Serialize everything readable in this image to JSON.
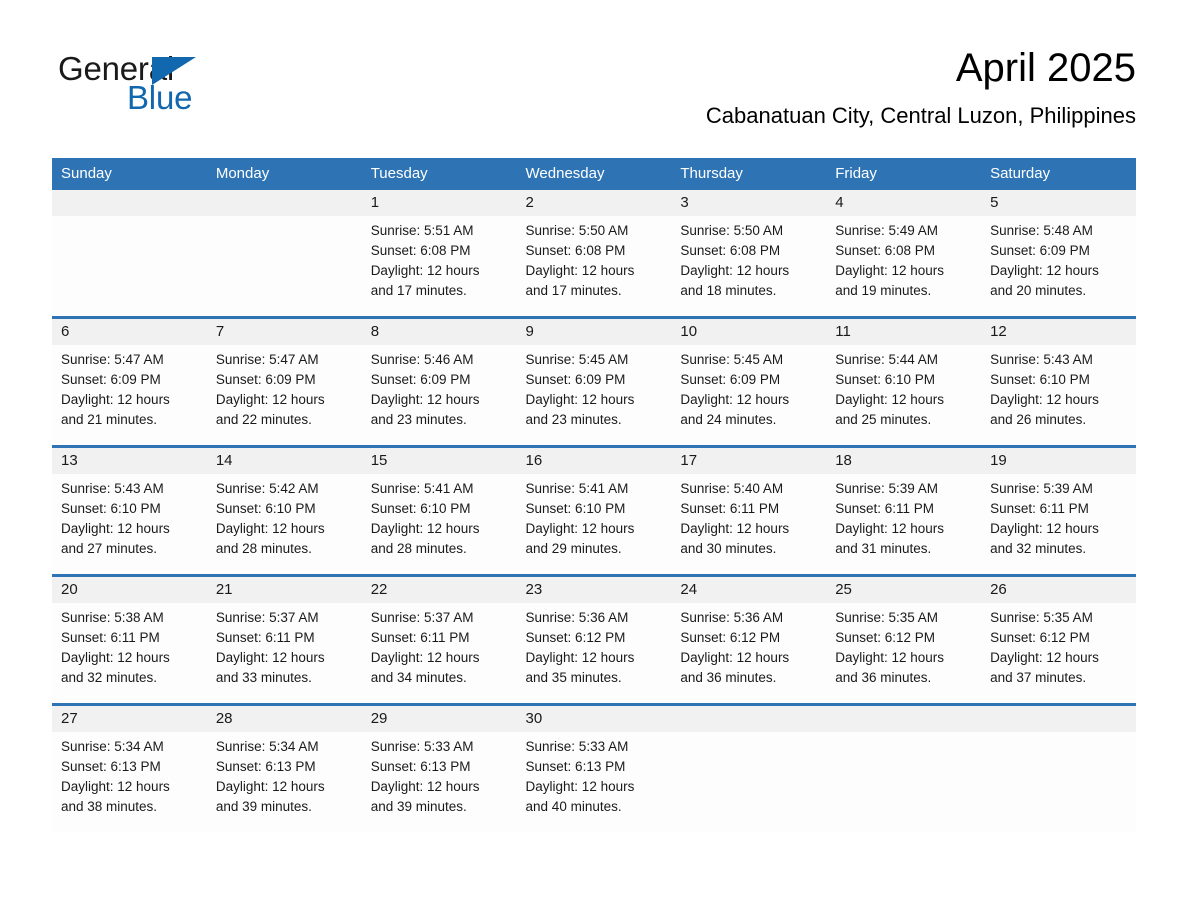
{
  "logo": {
    "word_dark": "General",
    "word_blue": "Blue",
    "triangle_icon": "triangle-icon",
    "brand_blue": "#1168ae"
  },
  "header": {
    "month_title": "April 2025",
    "location": "Cabanatuan City, Central Luzon, Philippines",
    "accent_blue": "#2e74b5",
    "daynum_band": "#f1f1f1"
  },
  "weekday_headers": [
    "Sunday",
    "Monday",
    "Tuesday",
    "Wednesday",
    "Thursday",
    "Friday",
    "Saturday"
  ],
  "weeks": [
    {
      "days": [
        {
          "num": "",
          "lines": []
        },
        {
          "num": "",
          "lines": []
        },
        {
          "num": "1",
          "lines": [
            "Sunrise: 5:51 AM",
            "Sunset: 6:08 PM",
            "Daylight: 12 hours",
            "and 17 minutes."
          ]
        },
        {
          "num": "2",
          "lines": [
            "Sunrise: 5:50 AM",
            "Sunset: 6:08 PM",
            "Daylight: 12 hours",
            "and 17 minutes."
          ]
        },
        {
          "num": "3",
          "lines": [
            "Sunrise: 5:50 AM",
            "Sunset: 6:08 PM",
            "Daylight: 12 hours",
            "and 18 minutes."
          ]
        },
        {
          "num": "4",
          "lines": [
            "Sunrise: 5:49 AM",
            "Sunset: 6:08 PM",
            "Daylight: 12 hours",
            "and 19 minutes."
          ]
        },
        {
          "num": "5",
          "lines": [
            "Sunrise: 5:48 AM",
            "Sunset: 6:09 PM",
            "Daylight: 12 hours",
            "and 20 minutes."
          ]
        }
      ]
    },
    {
      "days": [
        {
          "num": "6",
          "lines": [
            "Sunrise: 5:47 AM",
            "Sunset: 6:09 PM",
            "Daylight: 12 hours",
            "and 21 minutes."
          ]
        },
        {
          "num": "7",
          "lines": [
            "Sunrise: 5:47 AM",
            "Sunset: 6:09 PM",
            "Daylight: 12 hours",
            "and 22 minutes."
          ]
        },
        {
          "num": "8",
          "lines": [
            "Sunrise: 5:46 AM",
            "Sunset: 6:09 PM",
            "Daylight: 12 hours",
            "and 23 minutes."
          ]
        },
        {
          "num": "9",
          "lines": [
            "Sunrise: 5:45 AM",
            "Sunset: 6:09 PM",
            "Daylight: 12 hours",
            "and 23 minutes."
          ]
        },
        {
          "num": "10",
          "lines": [
            "Sunrise: 5:45 AM",
            "Sunset: 6:09 PM",
            "Daylight: 12 hours",
            "and 24 minutes."
          ]
        },
        {
          "num": "11",
          "lines": [
            "Sunrise: 5:44 AM",
            "Sunset: 6:10 PM",
            "Daylight: 12 hours",
            "and 25 minutes."
          ]
        },
        {
          "num": "12",
          "lines": [
            "Sunrise: 5:43 AM",
            "Sunset: 6:10 PM",
            "Daylight: 12 hours",
            "and 26 minutes."
          ]
        }
      ]
    },
    {
      "days": [
        {
          "num": "13",
          "lines": [
            "Sunrise: 5:43 AM",
            "Sunset: 6:10 PM",
            "Daylight: 12 hours",
            "and 27 minutes."
          ]
        },
        {
          "num": "14",
          "lines": [
            "Sunrise: 5:42 AM",
            "Sunset: 6:10 PM",
            "Daylight: 12 hours",
            "and 28 minutes."
          ]
        },
        {
          "num": "15",
          "lines": [
            "Sunrise: 5:41 AM",
            "Sunset: 6:10 PM",
            "Daylight: 12 hours",
            "and 28 minutes."
          ]
        },
        {
          "num": "16",
          "lines": [
            "Sunrise: 5:41 AM",
            "Sunset: 6:10 PM",
            "Daylight: 12 hours",
            "and 29 minutes."
          ]
        },
        {
          "num": "17",
          "lines": [
            "Sunrise: 5:40 AM",
            "Sunset: 6:11 PM",
            "Daylight: 12 hours",
            "and 30 minutes."
          ]
        },
        {
          "num": "18",
          "lines": [
            "Sunrise: 5:39 AM",
            "Sunset: 6:11 PM",
            "Daylight: 12 hours",
            "and 31 minutes."
          ]
        },
        {
          "num": "19",
          "lines": [
            "Sunrise: 5:39 AM",
            "Sunset: 6:11 PM",
            "Daylight: 12 hours",
            "and 32 minutes."
          ]
        }
      ]
    },
    {
      "days": [
        {
          "num": "20",
          "lines": [
            "Sunrise: 5:38 AM",
            "Sunset: 6:11 PM",
            "Daylight: 12 hours",
            "and 32 minutes."
          ]
        },
        {
          "num": "21",
          "lines": [
            "Sunrise: 5:37 AM",
            "Sunset: 6:11 PM",
            "Daylight: 12 hours",
            "and 33 minutes."
          ]
        },
        {
          "num": "22",
          "lines": [
            "Sunrise: 5:37 AM",
            "Sunset: 6:11 PM",
            "Daylight: 12 hours",
            "and 34 minutes."
          ]
        },
        {
          "num": "23",
          "lines": [
            "Sunrise: 5:36 AM",
            "Sunset: 6:12 PM",
            "Daylight: 12 hours",
            "and 35 minutes."
          ]
        },
        {
          "num": "24",
          "lines": [
            "Sunrise: 5:36 AM",
            "Sunset: 6:12 PM",
            "Daylight: 12 hours",
            "and 36 minutes."
          ]
        },
        {
          "num": "25",
          "lines": [
            "Sunrise: 5:35 AM",
            "Sunset: 6:12 PM",
            "Daylight: 12 hours",
            "and 36 minutes."
          ]
        },
        {
          "num": "26",
          "lines": [
            "Sunrise: 5:35 AM",
            "Sunset: 6:12 PM",
            "Daylight: 12 hours",
            "and 37 minutes."
          ]
        }
      ]
    },
    {
      "days": [
        {
          "num": "27",
          "lines": [
            "Sunrise: 5:34 AM",
            "Sunset: 6:13 PM",
            "Daylight: 12 hours",
            "and 38 minutes."
          ]
        },
        {
          "num": "28",
          "lines": [
            "Sunrise: 5:34 AM",
            "Sunset: 6:13 PM",
            "Daylight: 12 hours",
            "and 39 minutes."
          ]
        },
        {
          "num": "29",
          "lines": [
            "Sunrise: 5:33 AM",
            "Sunset: 6:13 PM",
            "Daylight: 12 hours",
            "and 39 minutes."
          ]
        },
        {
          "num": "30",
          "lines": [
            "Sunrise: 5:33 AM",
            "Sunset: 6:13 PM",
            "Daylight: 12 hours",
            "and 40 minutes."
          ]
        },
        {
          "num": "",
          "lines": []
        },
        {
          "num": "",
          "lines": []
        },
        {
          "num": "",
          "lines": []
        }
      ]
    }
  ]
}
